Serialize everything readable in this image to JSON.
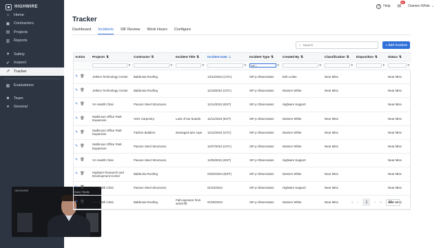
{
  "brand": {
    "name": "HIGHWIRE"
  },
  "sidebar": {
    "items": [
      {
        "label": "Home",
        "icon": "home-icon",
        "glyph": "⌂"
      },
      {
        "label": "Contractors",
        "icon": "contractors-icon",
        "glyph": "▣"
      },
      {
        "label": "Projects",
        "icon": "projects-icon",
        "glyph": "▤"
      },
      {
        "label": "Reports",
        "icon": "reports-icon",
        "glyph": "▥"
      }
    ],
    "items2": [
      {
        "label": "Safety",
        "icon": "safety-icon",
        "glyph": "♥"
      },
      {
        "label": "Inspect",
        "icon": "inspect-icon",
        "glyph": "✔"
      },
      {
        "label": "Tracker",
        "icon": "tracker-icon",
        "glyph": "↗",
        "active": true
      }
    ],
    "items3": [
      {
        "label": "Evaluations",
        "icon": "evaluations-icon",
        "glyph": "▦"
      }
    ],
    "items4": [
      {
        "label": "Team",
        "icon": "team-icon",
        "glyph": "☻"
      },
      {
        "label": "General",
        "icon": "general-icon",
        "glyph": "●"
      }
    ]
  },
  "video": {
    "label": "HIGHWIRE",
    "name": "Dave Tillotts",
    "subtitle": "Vice President"
  },
  "topbar": {
    "help": "Help",
    "notifications": "99",
    "user": "Damien White"
  },
  "page": {
    "title": "Tracker"
  },
  "tabs": [
    "Dashboard",
    "Incidents",
    "SIF Review",
    "Work Hours",
    "Configure"
  ],
  "active_tab": 1,
  "search": {
    "placeholder": "Search"
  },
  "add_button": "+ Add Incident",
  "table": {
    "columns": [
      "Action",
      "Projects",
      "Contractor",
      "Incident Title",
      "Incident Date",
      "Incident Type",
      "Created By",
      "Classification",
      "Disposition",
      "Status"
    ],
    "sorted_column": 4,
    "filter_value_type": "SIF |",
    "rows": [
      [
        "Jellenn Technology Center",
        "Babbonia Roofing",
        "",
        "12/12/2024 (UTC)",
        "SIF-p Observation",
        "Erik Lenke",
        "Near Miss",
        "",
        "Near Miss"
      ],
      [
        "Jellenn Technology Center",
        "Babbonia Roofing",
        "",
        "11/18/2024 (UTC)",
        "SIF-p Observation",
        "Damien White",
        "Near Miss",
        "",
        "Near Miss"
      ],
      [
        "VA Health Clinic",
        "Paxson Steel Structures",
        "",
        "11/14/2024 (EST)",
        "SIF-p Observation",
        "Highwire Support",
        "",
        "",
        "Near Miss"
      ],
      [
        "Nathinson Office Park Expansion",
        "HSG Carpentry",
        "Lack of toe boards",
        "11/11/2024 (EST)",
        "SIF-p Observation",
        "Damien White",
        "Near Miss",
        "",
        "Near Miss"
      ],
      [
        "Nathinson Office Park Expansion",
        "Fairline Builders",
        "Damaged wire rope",
        "11/11/2024 (UTC)",
        "SIF-p Observation",
        "Damien White",
        "Near Miss",
        "",
        "Near Miss"
      ],
      [
        "Nathinson Office Park Expansion",
        "Paxson Steel Structures",
        "",
        "11/07/2024 (UTC)",
        "SIF-p Observation",
        "Damien White",
        "Near Miss",
        "",
        "Near Miss"
      ],
      [
        "VA Health Clinic",
        "Paxson Steel Structures",
        "",
        "11/05/2024 (EST)",
        "SIF-p Observation",
        "Highwire Support",
        "",
        "",
        "Near Miss"
      ],
      [
        "Highwire Research and Development Center",
        "Babbonia Roofing",
        "",
        "03/20/2024 (EDT)",
        "SIF-p Observation",
        "Damien White",
        "Near Miss",
        "",
        "Near Miss"
      ],
      [
        "VA Health Clinic",
        "Paxson Steel Structures",
        "",
        "01/22/2024",
        "SIF-p Observation",
        "Highwire Support",
        "Near Miss",
        "",
        "Near Miss"
      ],
      [
        "VA Health Clinic",
        "Babbonia Roofing",
        "Fall exposure from aerial lift",
        "01/05/2024",
        "SIF-p Observation",
        "Damien White",
        "Near Miss",
        "",
        "Near Miss"
      ]
    ]
  },
  "pager": {
    "first": "«",
    "prev": "‹",
    "current": "1",
    "next": "›",
    "last": "»",
    "page_size": "20"
  },
  "colors": {
    "accent": "#2f6fd8",
    "sidebar": "#2c3541",
    "badge": "#e23b3b"
  }
}
